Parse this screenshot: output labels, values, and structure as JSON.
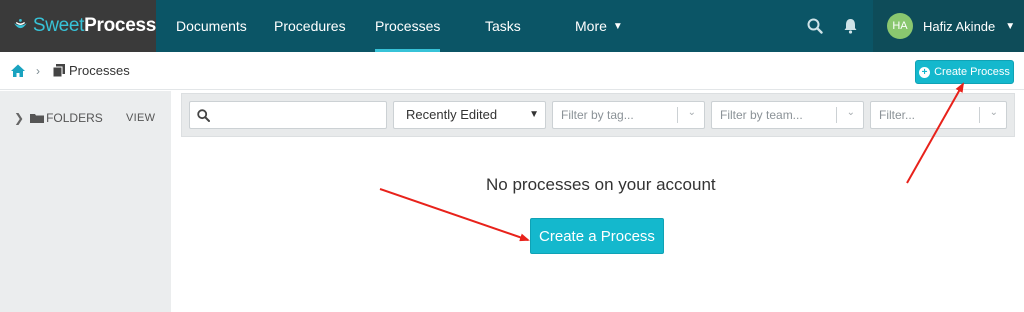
{
  "brand": {
    "sweet": "Sweet",
    "process": "Process"
  },
  "nav": {
    "items": [
      {
        "label": "Documents"
      },
      {
        "label": "Procedures"
      },
      {
        "label": "Processes"
      },
      {
        "label": "Tasks"
      },
      {
        "label": "More"
      }
    ],
    "active": "Processes"
  },
  "user": {
    "initials": "HA",
    "name": "Hafiz Akinde"
  },
  "breadcrumb": {
    "current": "Processes"
  },
  "header_action": {
    "label": "Create Process"
  },
  "sidebar": {
    "folders_label": "FOLDERS",
    "view_label": "VIEW"
  },
  "filters": {
    "search_placeholder": "",
    "sort_selected": "Recently Edited",
    "tag_placeholder": "Filter by tag...",
    "team_placeholder": "Filter by team...",
    "other_placeholder": "Filter..."
  },
  "empty_state": {
    "message": "No processes on your account",
    "button_label": "Create a Process"
  },
  "colors": {
    "nav_bg": "#0b5566",
    "accent": "#14b8cd",
    "annotation_arrow": "#e8221b",
    "avatar_bg": "#8ac76f"
  },
  "icons": [
    "search-icon",
    "bell-icon",
    "home-icon",
    "document-icon",
    "folder-icon",
    "plus-circle-icon"
  ]
}
